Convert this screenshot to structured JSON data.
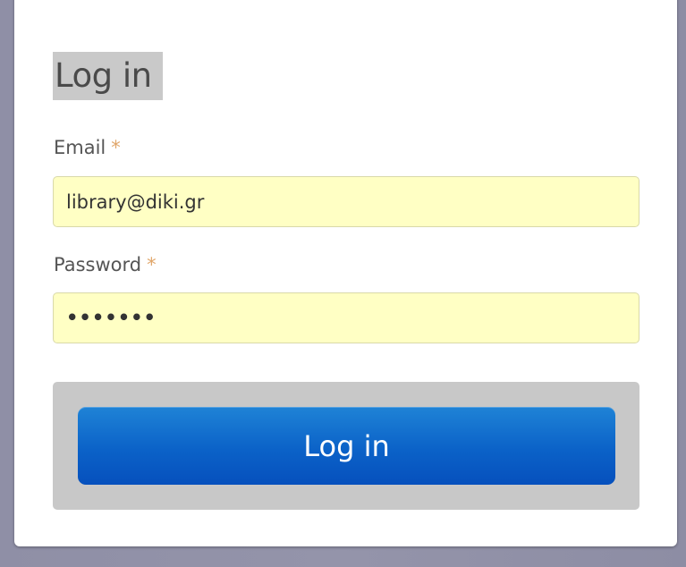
{
  "form": {
    "title": "Log in",
    "required_marker": "*",
    "email": {
      "label": "Email",
      "value": "library@diki.gr"
    },
    "password": {
      "label": "Password",
      "masked_value": "•••••••"
    },
    "submit_label": "Log in"
  },
  "colors": {
    "input_background": "#ffffc4",
    "button_primary": "#0b62c8",
    "required_marker": "#e0a66a",
    "panel_gray": "#c8c8c8"
  }
}
